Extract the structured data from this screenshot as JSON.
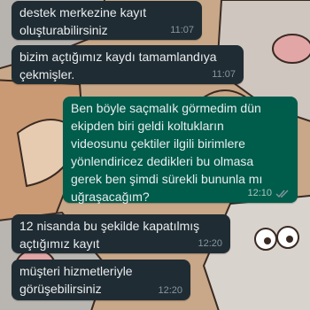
{
  "colors": {
    "incoming_bubble": "#202c33",
    "outgoing_bubble": "#005c4b",
    "message_text": "#e9edef",
    "timestamp": "#8696a0",
    "read_ticks": "#8696a0"
  },
  "wallpaper": {
    "description_icon": "cartoon-cat-wallpaper"
  },
  "messages": [
    {
      "direction": "incoming",
      "text": "destek merkezine kayıt\noluşturabilirsiniz",
      "time": "11:07"
    },
    {
      "direction": "incoming",
      "text": "bizim açtığımız kaydı tamamlandıya\nçekmişler.",
      "time": "11:07"
    },
    {
      "direction": "outgoing",
      "text": "Ben böyle saçmalık görmedim dün\nekipden biri geldi koltukların\nvideosunu çektiler ilgili birimlere\nyönlendiricez dedikleri bu olmasa\ngerek ben şimdi sürekli bununla mı\nuğraşacağım?",
      "time": "12:10",
      "status_icon": "double-check-icon"
    },
    {
      "direction": "incoming",
      "text": "12 nisanda bu şekilde kapatılmış\naçtığımız kayıt",
      "time": "12:20"
    },
    {
      "direction": "incoming",
      "text": "müşteri hizmetleriyle\ngörüşebilirsiniz",
      "time": "12:20"
    }
  ]
}
